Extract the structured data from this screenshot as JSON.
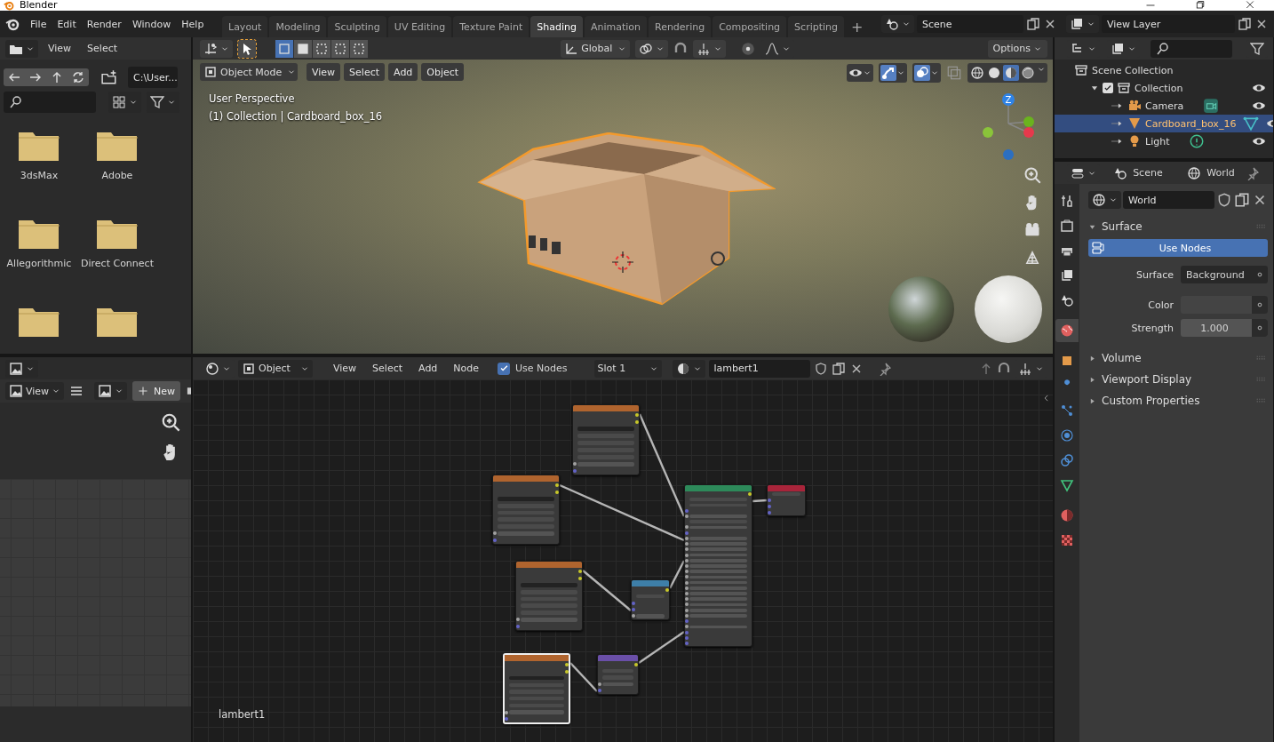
{
  "window": {
    "title": "Blender"
  },
  "menus": [
    "File",
    "Edit",
    "Render",
    "Window",
    "Help"
  ],
  "workspaces": [
    {
      "label": "Layout",
      "selected": false
    },
    {
      "label": "Modeling",
      "selected": false
    },
    {
      "label": "Sculpting",
      "selected": false
    },
    {
      "label": "UV Editing",
      "selected": false
    },
    {
      "label": "Texture Paint",
      "selected": false
    },
    {
      "label": "Shading",
      "selected": true
    },
    {
      "label": "Animation",
      "selected": false
    },
    {
      "label": "Rendering",
      "selected": false
    },
    {
      "label": "Compositing",
      "selected": false
    },
    {
      "label": "Scripting",
      "selected": false
    }
  ],
  "add_workspace": "+",
  "scene": "Scene",
  "view_layer": "View Layer",
  "file_browser": {
    "menus": [
      "View",
      "Select"
    ],
    "path": "C:\\User...",
    "folders": [
      {
        "kind": "labeled",
        "name": "3dsMax"
      },
      {
        "kind": "labeled",
        "name": "Adobe"
      },
      {
        "kind": "labeled",
        "name": "Allegorithmic"
      },
      {
        "kind": "labeled",
        "name": "Direct Connect"
      },
      {
        "kind": "cut"
      },
      {
        "kind": "cut"
      }
    ]
  },
  "image_editor": {
    "view": "View",
    "new_button": "New"
  },
  "viewport": {
    "gizmos_on": true,
    "overlays_on": true,
    "axis_label": "Z",
    "select_modes": [
      {
        "selected": true
      },
      {
        "selected": false
      },
      {
        "selected": false
      },
      {
        "selected": false
      },
      {
        "selected": false
      }
    ],
    "orientation": "Global",
    "options": "Options",
    "mode": "Object Mode",
    "menus": [
      "View",
      "Select",
      "Add",
      "Object"
    ],
    "shading": [
      {
        "kind": "wireframe",
        "selected": false
      },
      {
        "kind": "solid",
        "selected": false
      },
      {
        "kind": "material",
        "selected": true
      },
      {
        "kind": "rendered",
        "selected": false
      }
    ],
    "info": [
      "User Perspective",
      "(1) Collection | Cardboard_box_16"
    ]
  },
  "node_editor": {
    "type": "Object",
    "menus": [
      "View",
      "Select",
      "Add",
      "Node"
    ],
    "use_nodes": {
      "label": "Use Nodes",
      "checked": true
    },
    "slot": "Slot 1",
    "material": "lambert1",
    "footer": "lambert1",
    "nodes": [
      {
        "kind": "image",
        "selected": false
      },
      {
        "kind": "image",
        "selected": false
      },
      {
        "kind": "image",
        "selected": false
      },
      {
        "kind": "image",
        "selected": true
      },
      {
        "kind": "principled",
        "selected": false
      },
      {
        "kind": "output",
        "selected": false
      },
      {
        "kind": "math",
        "selected": false
      },
      {
        "kind": "normal_map",
        "selected": false
      }
    ]
  },
  "outliner": {
    "items": [
      {
        "label": "Scene Collection",
        "kind": "collection",
        "selected": false,
        "children": [
          {
            "label": "Collection",
            "kind": "collection",
            "checked": true,
            "expanded": true,
            "selected": false,
            "children": [
              {
                "label": "Camera",
                "kind": "camera",
                "selected": false
              },
              {
                "label": "Cardboard_box_16",
                "kind": "mesh",
                "selected": true
              },
              {
                "label": "Light",
                "kind": "light",
                "selected": false
              }
            ]
          }
        ]
      }
    ]
  },
  "properties": {
    "context": [
      "Scene",
      "World"
    ],
    "tabs": [
      {
        "kind": "tool",
        "selected": false
      },
      {
        "kind": "render",
        "selected": false
      },
      {
        "kind": "output",
        "selected": false
      },
      {
        "kind": "view_layer",
        "selected": false
      },
      {
        "kind": "scene",
        "selected": false
      },
      {
        "kind": "world",
        "selected": true
      },
      {
        "kind": "object",
        "selected": false
      },
      {
        "kind": "modifier",
        "selected": false
      },
      {
        "kind": "particles",
        "selected": false
      },
      {
        "kind": "physics",
        "selected": false
      },
      {
        "kind": "constraints",
        "selected": false
      },
      {
        "kind": "data",
        "selected": false
      },
      {
        "kind": "material",
        "selected": false
      },
      {
        "kind": "texture",
        "selected": false
      }
    ],
    "datablock": "World",
    "use_nodes_button": "Use Nodes",
    "panels": [
      {
        "title": "Surface",
        "expanded": true
      },
      {
        "title": "Volume",
        "expanded": false
      },
      {
        "title": "Viewport Display",
        "expanded": false
      },
      {
        "title": "Custom Properties",
        "expanded": false
      }
    ],
    "fields": [
      {
        "kind": "menu",
        "label": "Surface",
        "value": "Background"
      },
      {
        "kind": "color",
        "label": "Color"
      },
      {
        "kind": "number",
        "label": "Strength",
        "value": "1.000"
      }
    ]
  }
}
